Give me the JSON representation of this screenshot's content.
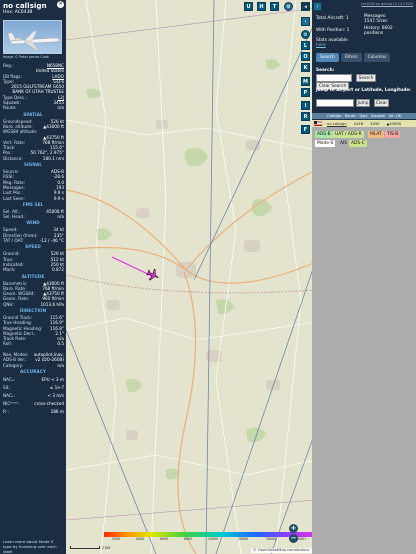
{
  "aircraft": {
    "callsign": "no callsign",
    "hex_label": "Hex:",
    "hex": "AC643B",
    "photo_credit": "Image © Peter James Cook"
  },
  "details": {
    "reg_label": "Reg.:",
    "reg": "N658NC",
    "country": "United States",
    "dbflags_label": "DB flags:",
    "dbflags": "LADD",
    "type_label": "Type:",
    "type": "GLF6",
    "model": "2015 GULFSTREAM G650",
    "owner": "BANK OF UTAH TRUSTEE",
    "typedesc_label": "Type Desc.:",
    "typedesc": "L2J",
    "squawk_label": "Squawk:",
    "squawk": "3455",
    "route_label": "Route:",
    "route": "n/a"
  },
  "spatial": {
    "header": "SPATIAL",
    "gs_label": "Groundspeed:",
    "gs": "526 kt",
    "baro_label": "Baro. altitude:",
    "baro": "▲43000 ft",
    "wgs_label": "WGS84 altitude:",
    "wgs": "▲43750 ft",
    "vrate_label": "Vert. Rate:",
    "vrate": "768 ft/min",
    "track_label": "Track:",
    "track": "115.6°",
    "pos_label": "Pos.:",
    "pos": "50.762°, 2.975°",
    "dist_label": "Distance:",
    "dist": "180.1 nmi"
  },
  "signal": {
    "header": "SIGNAL",
    "source_label": "Source:",
    "source": "ADS-B",
    "rssi_label": "RSSI:",
    "rssi": "-28.6",
    "msgrate_label": "Msg. Rate:",
    "msgrate": "0.0",
    "msgs_label": "Messages:",
    "msgs": "193",
    "lastpos_label": "Last Pos.:",
    "lastpos": "9.9 s",
    "lastseen_label": "Last Seen:",
    "lastseen": "9.9 s"
  },
  "fms": {
    "header": "FMS SEL",
    "selalt_label": "Sel. Alt.:",
    "selalt": "45008 ft",
    "selhead_label": "Sel. Head.:",
    "selhead": "n/a"
  },
  "wind": {
    "header": "WIND",
    "speed_label": "Speed:",
    "speed": "34 kt",
    "dir_label": "Direction (from):",
    "dir": "235°",
    "tat_label": "TAT / OAT:",
    "tat": "-12 / -46 °C"
  },
  "speed": {
    "header": "SPEED",
    "ground_label": "Ground:",
    "ground": "526 kt",
    "true_label": "True:",
    "true": "512 kt",
    "ind_label": "Indicated:",
    "ind": "250 kt",
    "mach_label": "Mach:",
    "mach": "0.872"
  },
  "altitude": {
    "header": "ALTITUDE",
    "baro_label": "Barometric:",
    "baro": "▲43000 ft",
    "barorate_label": "Baro. Rate:",
    "barorate": "768 ft/min",
    "geom_label": "Geom. WGS84:",
    "geom": "▲43750 ft",
    "geomrate_label": "Geom. Rate:",
    "geomrate": "960 ft/min",
    "qnh_label": "QNH:",
    "qnh": "1013.6 hPa"
  },
  "direction": {
    "header": "DIRECTION",
    "gtrack_label": "Ground Track:",
    "gtrack": "115.6°",
    "thead_label": "True Heading:",
    "thead": "116.9°",
    "mhead_label": "Magnetic Heading:",
    "mhead": "116.8°",
    "mdecl_label": "Magnetic Decl.:",
    "mdecl": "2.1°",
    "trackrate_label": "Track Rate:",
    "trackrate": "n/a",
    "roll_label": "Roll:",
    "roll": "0.5"
  },
  "misc": {
    "navmodes_label": "Nav. Modes:",
    "navmodes": "autopilot,lnav,",
    "adsbver_label": "ADS-B Ver.:",
    "adsbver": "v2 (DO-260B)",
    "category_label": "Category:",
    "category": "n/a"
  },
  "accuracy": {
    "header": "ACCURACY",
    "nacp_label": "NACₚ:",
    "nacp": "EPU < 3 m",
    "sil_label": "SIL:",
    "sil": "≤ 1e-7",
    "nacv_label": "NACᵥ:",
    "nacv": "< 3 m/s",
    "nicbaro_label": "NICᴮᴬᴿᴼ:",
    "nicbaro": "cross-checked",
    "rc_label": "Rᶜ:",
    "rc": "186 m"
  },
  "learn_more": "Learn more about Mode S type by hovering over each label",
  "map": {
    "top_buttons": [
      "U",
      "H",
      "T"
    ],
    "side_buttons": [
      "L",
      "O",
      "K",
      "M",
      "P",
      "I",
      "R",
      "F"
    ],
    "scale_text": "2 NM",
    "attribution": "© OpenStreetMap contributors.",
    "colorbar_ticks": [
      "2000",
      "4000",
      "6000",
      "8000",
      "10000",
      "20000",
      "30000",
      "40000+"
    ],
    "zoom_in": "+",
    "zoom_out": "−"
  },
  "right_panel": {
    "version_link": "tar1090 on github (3.14.1700)",
    "total_aircraft": "Total Aircraft: 1",
    "with_position": "With Position: 1",
    "messages": "Messages:",
    "msg_rate": "1547.5/sec",
    "history": "History: 6602",
    "history2": "positions",
    "stats_available": "Stats available",
    "stats_link": "here",
    "tabs": [
      "Search",
      "Filters",
      "Columns"
    ],
    "search_label": "Search:",
    "search_button": "Search",
    "clear_search": "Clear Search",
    "jump_label": "Jump to Airport or Latitude, Longitude:",
    "jump_button": "Jump",
    "clear_button": "Clear",
    "columns": [
      "Callsign",
      "Route",
      "Type",
      "Squawk",
      "Alt. (ft)"
    ],
    "row": {
      "callsign": "no callsign",
      "type": "GLF6",
      "squawk": "3455",
      "altitude": "▲43000"
    },
    "badges": [
      "ADS-B",
      "UAT / ADS-R",
      "MLAT",
      "TIS-B",
      "Mode-S",
      "AIS",
      "ADS-C"
    ]
  },
  "colors": {
    "panel": "#1a2d42",
    "accent": "#00587a",
    "section_header": "#6fb2e6",
    "map_bg": "#e4e3cd"
  }
}
